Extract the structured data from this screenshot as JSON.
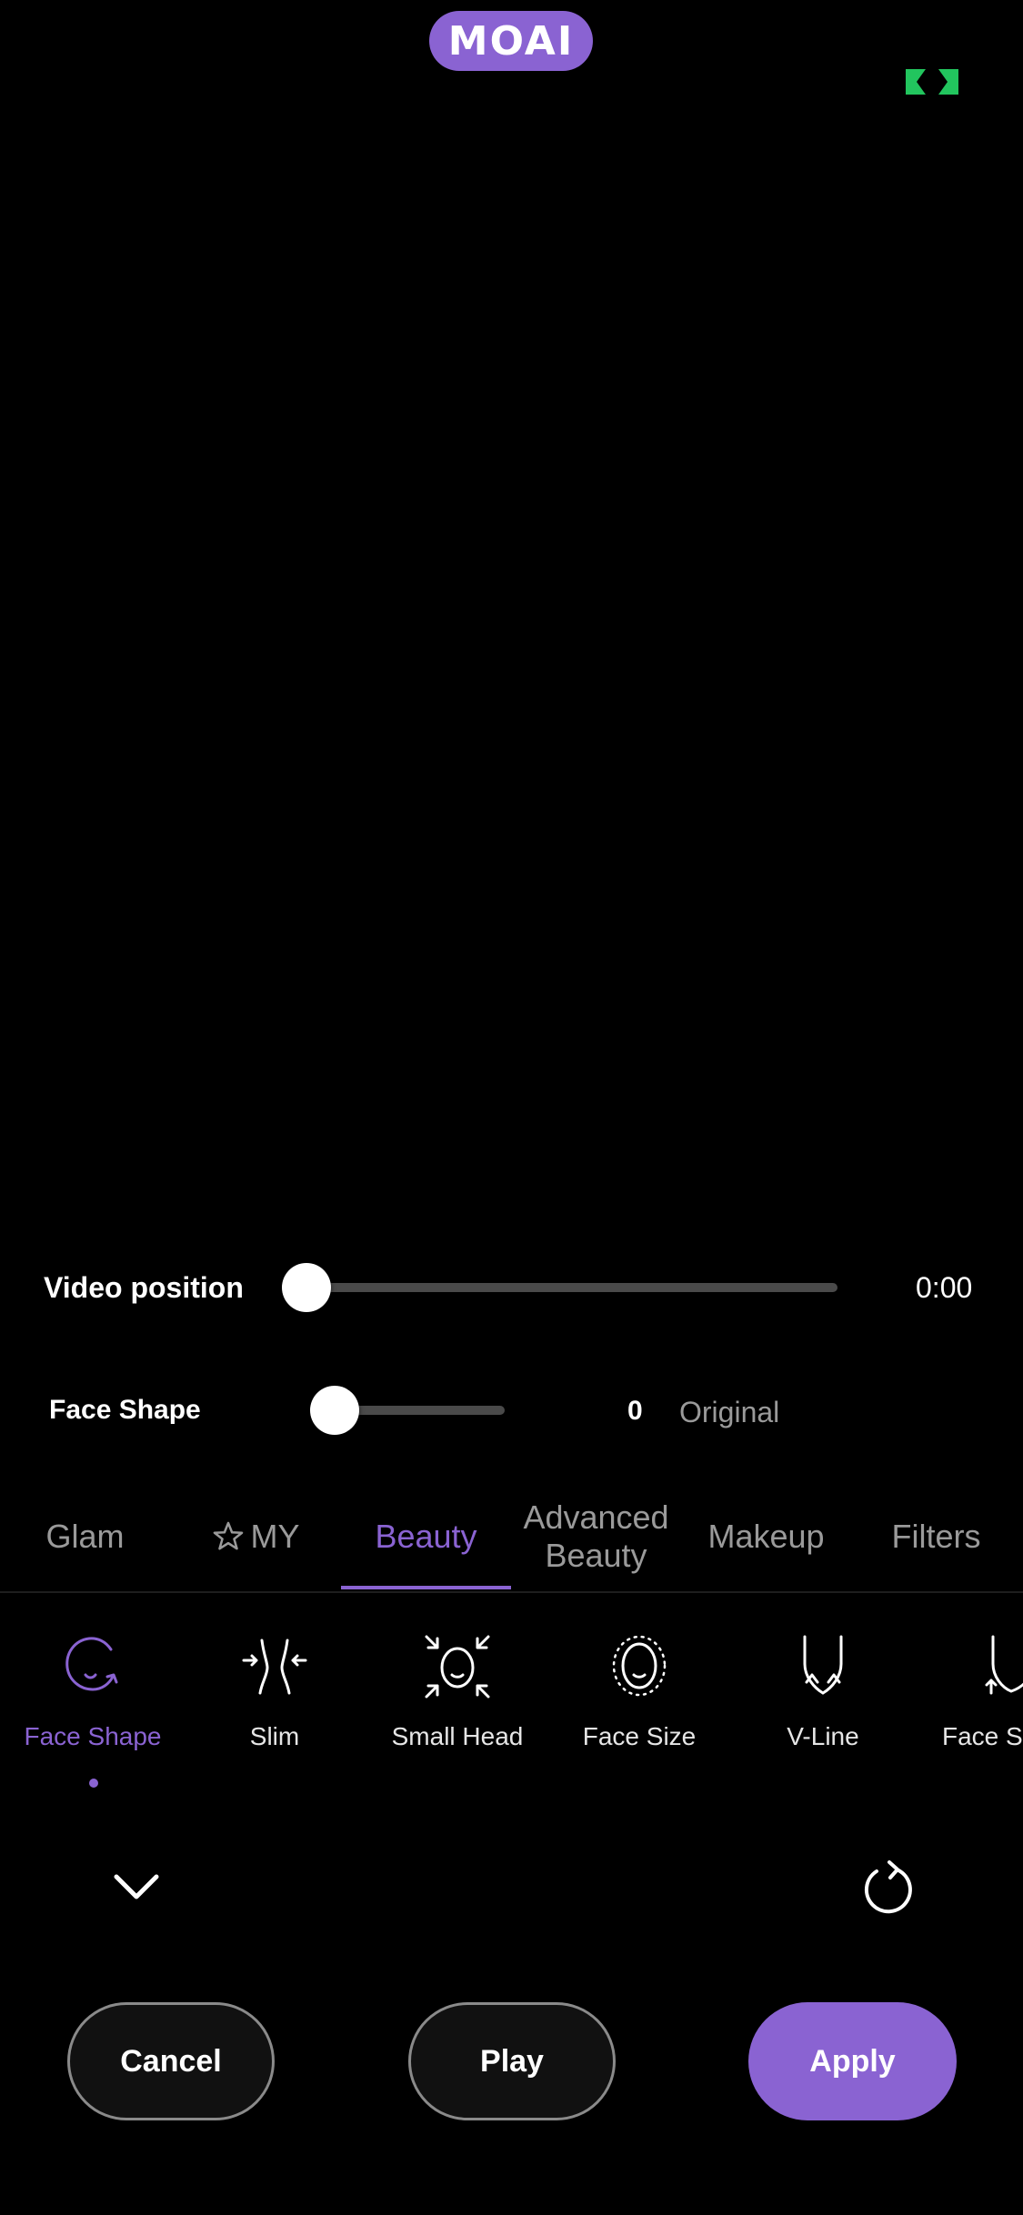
{
  "header": {
    "logo_text": "MOAI",
    "brand_color": "#8A63D2",
    "expand_icon": "expand-icon",
    "expand_color": "#22C55E"
  },
  "video_position": {
    "label": "Video position",
    "time": "0:00",
    "progress": 0
  },
  "face_shape_slider": {
    "label": "Face Shape",
    "value": "0",
    "status": "Original",
    "level": 0
  },
  "tabs": [
    {
      "label": "Glam"
    },
    {
      "label": "MY",
      "icon": "star-icon"
    },
    {
      "label": "Beauty",
      "active": true
    },
    {
      "label": "Advanced\nBeauty"
    },
    {
      "label": "Makeup"
    },
    {
      "label": "Filters"
    }
  ],
  "features": [
    {
      "label": "Face Shape",
      "icon": "face-shape-icon",
      "active": true
    },
    {
      "label": "Slim",
      "icon": "slim-icon"
    },
    {
      "label": "Small Head",
      "icon": "small-head-icon"
    },
    {
      "label": "Face Size",
      "icon": "face-size-icon"
    },
    {
      "label": "V-Line",
      "icon": "v-line-icon"
    },
    {
      "label": "Face S",
      "icon": "face-s-icon"
    }
  ],
  "controls": {
    "collapse_icon": "chevron-down-icon",
    "reset_icon": "reset-icon"
  },
  "buttons": {
    "cancel": "Cancel",
    "play": "Play",
    "apply": "Apply"
  }
}
